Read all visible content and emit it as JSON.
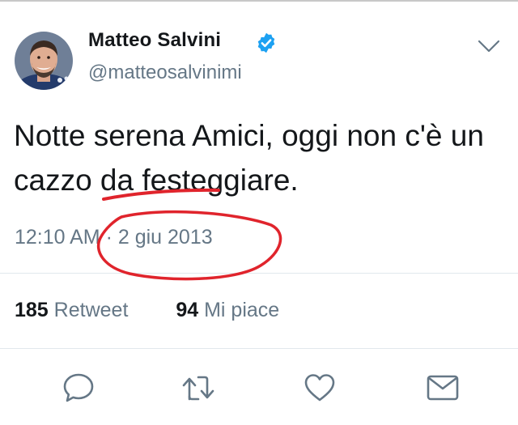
{
  "user": {
    "display_name": "Matteo Salvini",
    "handle": "@matteosalvinimi",
    "verified": true
  },
  "tweet": {
    "text": "Notte serena Amici, oggi non c'è un cazzo da festeggiare.",
    "time": "12:10 AM",
    "separator": "·",
    "date": "2 giu 2013"
  },
  "stats": {
    "retweets_count": "185",
    "retweets_label": "Retweet",
    "likes_count": "94",
    "likes_label": "Mi piace"
  },
  "actions": {
    "icons": [
      "reply-icon",
      "retweet-icon",
      "like-icon",
      "message-icon"
    ]
  },
  "colors": {
    "verified": "#1da1f2",
    "secondary_text": "#657786",
    "annotation": "#e0242c"
  }
}
